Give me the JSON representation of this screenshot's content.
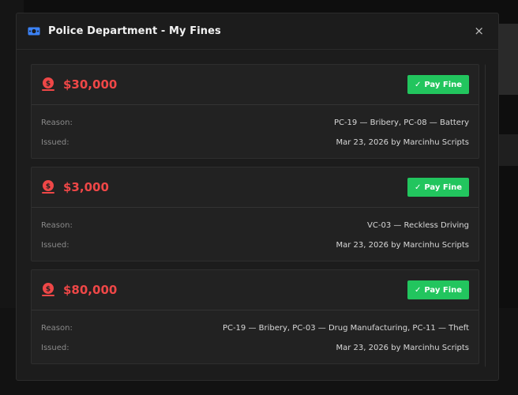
{
  "modal": {
    "title": "Police Department - My Fines",
    "header_icon": "money-bill-icon",
    "close_label": "×"
  },
  "colors": {
    "accent_red": "#ef4747",
    "pay_green": "#22c55e",
    "header_icon_blue": "#3b82f6"
  },
  "fines": [
    {
      "amount": "$30,000",
      "pay_label": "Pay Fine",
      "reason_label": "Reason:",
      "reason": "PC-19 — Bribery, PC-08 — Battery",
      "issued_label": "Issued:",
      "issued": "Mar 23, 2026 by Marcinhu Scripts"
    },
    {
      "amount": "$3,000",
      "pay_label": "Pay Fine",
      "reason_label": "Reason:",
      "reason": "VC-03 — Reckless Driving",
      "issued_label": "Issued:",
      "issued": "Mar 23, 2026 by Marcinhu Scripts"
    },
    {
      "amount": "$80,000",
      "pay_label": "Pay Fine",
      "reason_label": "Reason:",
      "reason": "PC-19 — Bribery, PC-03 — Drug Manufacturing, PC-11 — Theft",
      "issued_label": "Issued:",
      "issued": "Mar 23, 2026 by Marcinhu Scripts"
    }
  ]
}
